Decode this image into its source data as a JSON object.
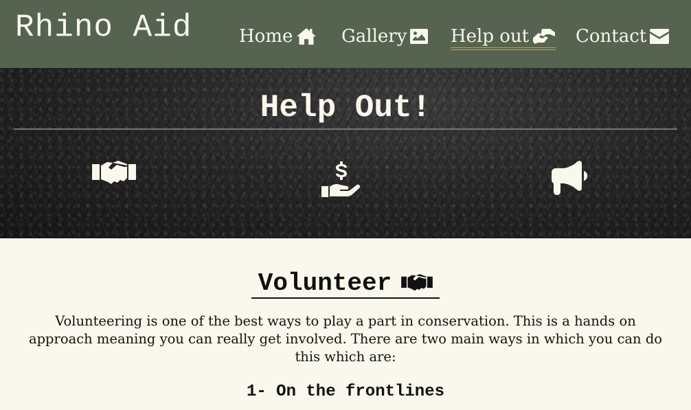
{
  "nav": {
    "brand": "Rhino Aid",
    "links": [
      {
        "label": "Home",
        "icon": "home-icon",
        "active": false
      },
      {
        "label": "Gallery",
        "icon": "image-icon",
        "active": false
      },
      {
        "label": "Help out",
        "icon": "hands-helping-icon",
        "active": true
      },
      {
        "label": "Contact",
        "icon": "envelope-icon",
        "active": false
      }
    ]
  },
  "hero": {
    "title": "Help Out!",
    "icons": [
      "handshake-icon",
      "hand-holding-dollar-icon",
      "bullhorn-icon"
    ]
  },
  "main": {
    "heading": "Volunteer",
    "heading_icon": "handshake-icon",
    "intro": "Volunteering is one of the best ways to play a part in conservation. This is a hands on approach meaning you can really get involved. There are two main ways in which you can do this which are:",
    "subheading": "1- On the frontlines"
  },
  "colors": {
    "nav_bg": "#566350",
    "text_light": "#f8f8ec",
    "page_bg": "#f8f8ec",
    "active_underline": "#b9a36a"
  }
}
